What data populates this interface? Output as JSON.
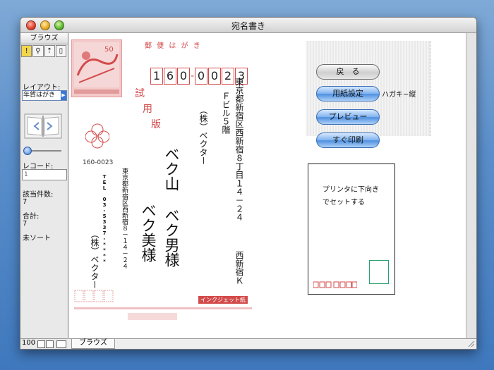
{
  "window": {
    "title": "宛名書き"
  },
  "sidebar": {
    "header": "ブラウズ",
    "tools": [
      "!",
      "⚲",
      "⇡",
      "▯"
    ],
    "layout_label": "レイアウト:",
    "layout_value": "年賀はがき",
    "record_label": "レコード:",
    "record_value": "1",
    "found_label": "該当件数:",
    "found_value": "7",
    "total_label": "合計:",
    "total_value": "7",
    "sort_status": "未ソート",
    "zoom": "100"
  },
  "statusbar": {
    "mode": "ブラウズ"
  },
  "postcard": {
    "header": "郵 便 は が き",
    "postal_code": [
      "1",
      "6",
      "0",
      "0",
      "0",
      "2",
      "3"
    ],
    "trial_text": [
      "試",
      "用",
      "版"
    ],
    "recipient_address": "東京都新宿区西新宿８丁目１４－２４",
    "recipient_address2": "西新宿Ｋ",
    "recipient_building": "Ｆビル５階",
    "recipient_company": "（株）ベクター",
    "recipient_name1": "ベク山 ベク男様",
    "recipient_name2": "ベク美様",
    "sender_postal": "160-0023",
    "sender_address": "東京都新宿区西新宿８－１４－２４",
    "sender_tel": "TEL 03-5337-****",
    "sender_company": "（株）ベクター",
    "footer_badge": "インクジェット紙"
  },
  "panel": {
    "back_button": "戻　る",
    "paper_button": "用紙設定",
    "paper_value": "ハガキ−縦",
    "preview_button": "プレビュー",
    "print_button": "すぐ印刷"
  },
  "preview": {
    "instruction": "プリンタに下向きでセットする"
  },
  "colors": {
    "accent_red": "#d34a4a",
    "button_blue": "#4d8fe0"
  }
}
